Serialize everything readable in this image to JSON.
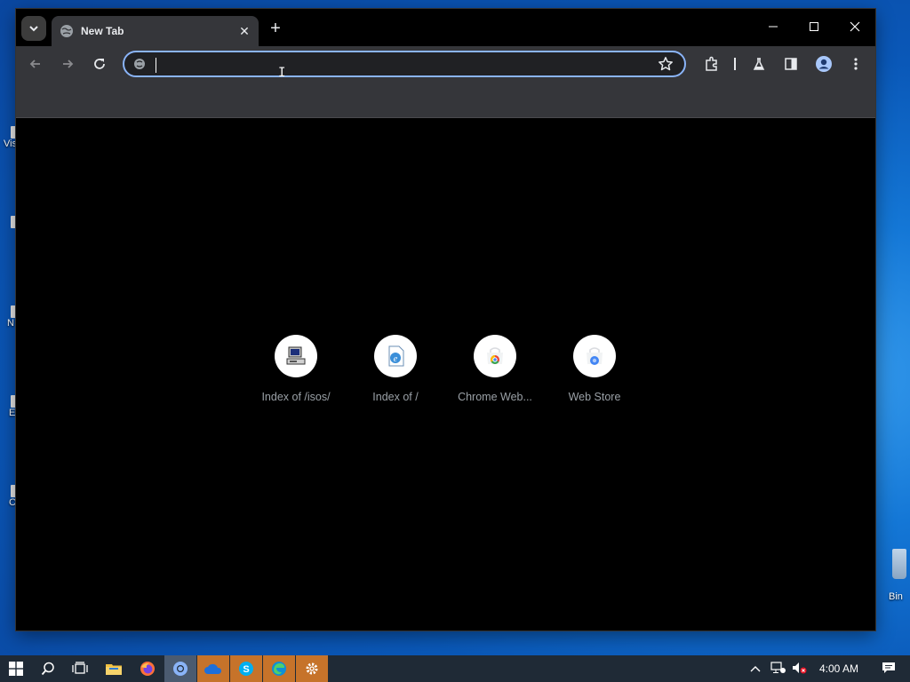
{
  "desktop": {
    "left_icons": [
      {
        "label": "Vis"
      },
      {
        "label": ""
      },
      {
        "label": "N"
      },
      {
        "label": "E"
      },
      {
        "label": "C"
      }
    ],
    "recycle_bin_label": "Bin"
  },
  "browser": {
    "tab": {
      "title": "New Tab",
      "favicon": "globe-icon"
    },
    "window_controls": [
      "minimize",
      "maximize",
      "close"
    ],
    "toolbar": {
      "back": "back-arrow-icon",
      "forward": "forward-arrow-icon",
      "reload": "reload-icon",
      "omnibox_value": "",
      "omnibox_placeholder": "",
      "right_icons": [
        "extensions-icon",
        "labs-flask-icon",
        "side-panel-icon",
        "profile-icon",
        "menu-kebab-icon"
      ]
    },
    "shortcuts": [
      {
        "label": "Index of /isos/",
        "icon": "computer-icon"
      },
      {
        "label": "Index of /",
        "icon": "ie-document-icon"
      },
      {
        "label": "Chrome Web...",
        "icon": "chrome-webstore-icon"
      },
      {
        "label": "Web Store",
        "icon": "webstore-icon"
      }
    ]
  },
  "taskbar": {
    "apps": [
      "start",
      "search",
      "task-view",
      "file-explorer",
      "firefox",
      "chrome",
      "onedrive",
      "skype",
      "edge",
      "settings"
    ],
    "time": "4:00 AM",
    "colors": {
      "running": "#c6732a",
      "active": "#4b5b70",
      "bar": "#1f2a36"
    }
  }
}
